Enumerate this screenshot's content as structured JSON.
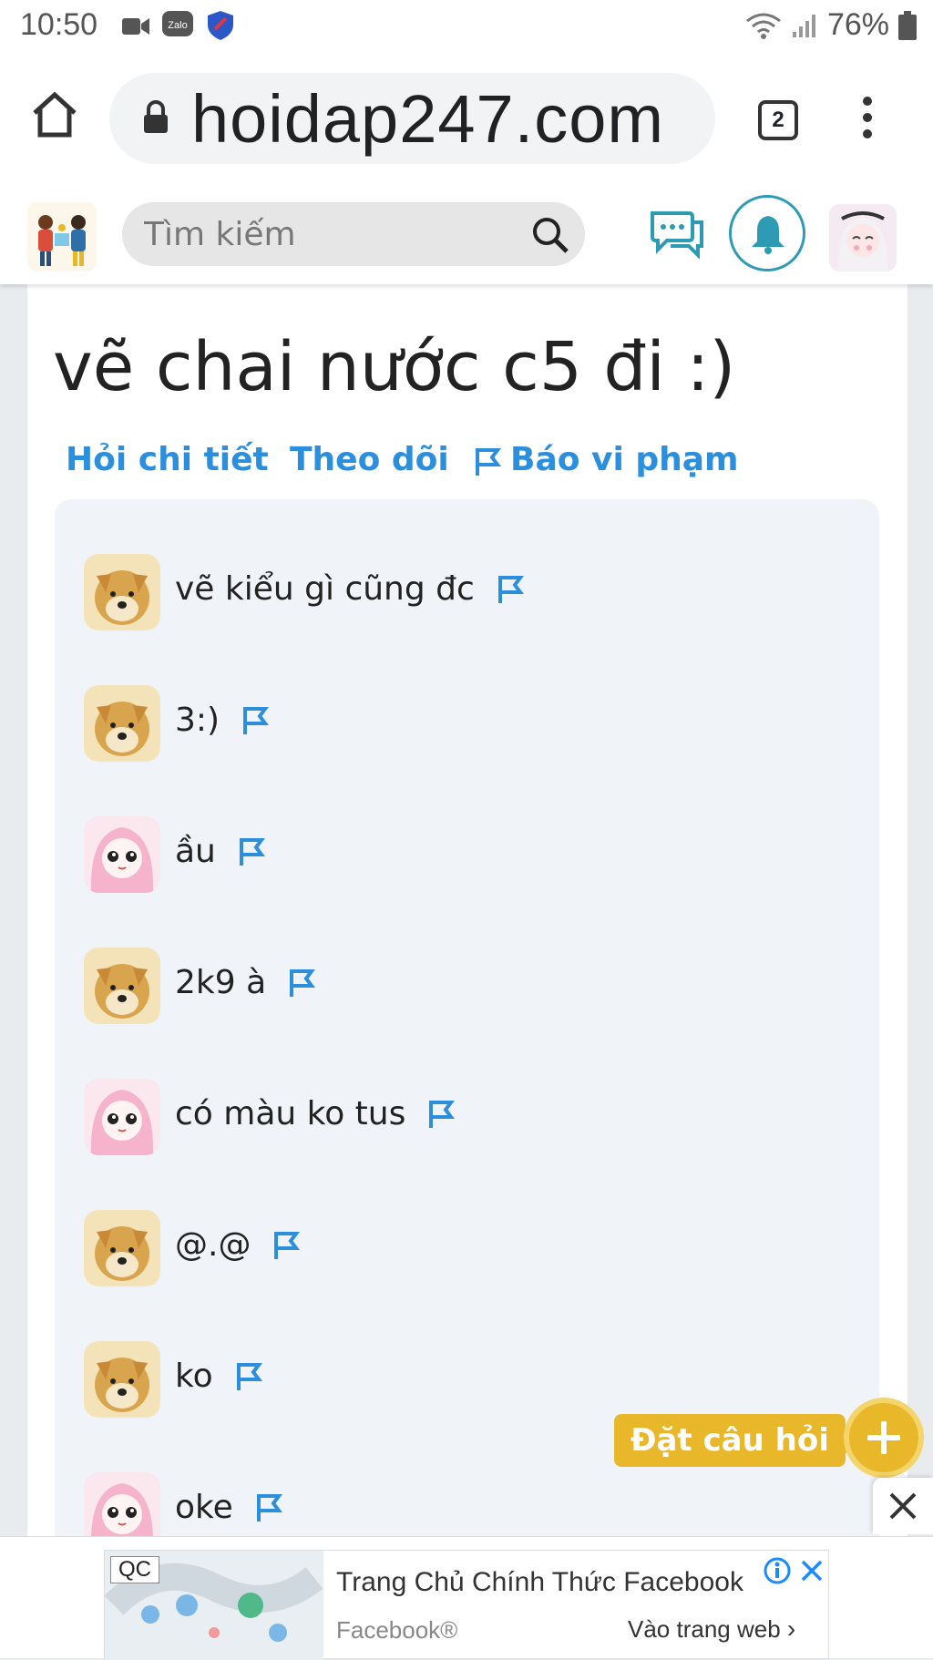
{
  "status_bar": {
    "time": "10:50",
    "battery": "76%",
    "icons": [
      "video-camera-icon",
      "zalo-icon",
      "shield-icon",
      "wifi-icon",
      "signal-icon",
      "battery-icon"
    ]
  },
  "browser": {
    "url": "hoidap247.com",
    "tab_count": "2",
    "icons": [
      "home-icon",
      "lock-icon",
      "more-vert-icon"
    ]
  },
  "site_header": {
    "search_placeholder": "Tìm kiếm",
    "icons": [
      "logo-icon",
      "search-icon",
      "chat-icon",
      "bell-icon",
      "user-avatar"
    ],
    "accent": "#2e9bb5"
  },
  "question": {
    "title": "vẽ chai nước c5 đi :)",
    "actions": {
      "ask_detail": "Hỏi chi tiết",
      "follow": "Theo dõi",
      "report": "Báo vi phạm"
    },
    "link_color": "#2b8fde"
  },
  "comments": [
    {
      "avatar": "doge",
      "text": "vẽ kiểu gì cũng đc"
    },
    {
      "avatar": "doge",
      "text": "3:)"
    },
    {
      "avatar": "anime",
      "text": "ầu"
    },
    {
      "avatar": "doge",
      "text": "2k9 à"
    },
    {
      "avatar": "anime",
      "text": "có màu ko tus"
    },
    {
      "avatar": "doge",
      "text": "@.@"
    },
    {
      "avatar": "doge",
      "text": "ko"
    },
    {
      "avatar": "anime",
      "text": "oke"
    }
  ],
  "fab": {
    "label": "Đặt câu hỏi",
    "color": "#e9b82a"
  },
  "ad": {
    "badge": "QC",
    "title": "Trang Chủ Chính Thức Facebook",
    "source": "Facebook®",
    "cta": "Vào trang web"
  }
}
